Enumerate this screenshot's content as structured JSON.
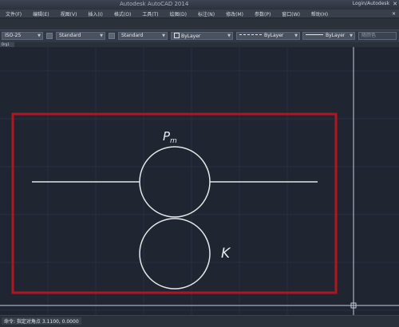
{
  "titlebar": {
    "title": "Autodesk AutoCAD 2014",
    "right": "Login/Autodesk",
    "close": "✕"
  },
  "menu": [
    "文件(F)",
    "编辑(E)",
    "视图(V)",
    "插入(I)",
    "格式(O)",
    "工具(T)",
    "绘图(D)",
    "标注(N)",
    "修改(M)",
    "参数(P)",
    "窗口(W)",
    "帮助(H)"
  ],
  "menu_close": "✕",
  "properties": {
    "dimstyle": "ISO-25",
    "textstyle": "Standard",
    "tablestyle": "Standard",
    "color": "ByLayer",
    "linetype": "ByLayer",
    "lineweight": "ByLayer",
    "plotstyle": "随颜色"
  },
  "tabs": {
    "drawing_tab": "Drg1"
  },
  "drawing": {
    "label_top": "P",
    "label_top_sub": "m",
    "label_right": "K"
  },
  "status": {
    "text": "命令: 指定对角点 3.1100, 0.0000 "
  },
  "colors": {
    "background": "#1f2631",
    "frame": "#b0171c",
    "lines": "#e4e6ea",
    "grid": "#2a3240"
  }
}
